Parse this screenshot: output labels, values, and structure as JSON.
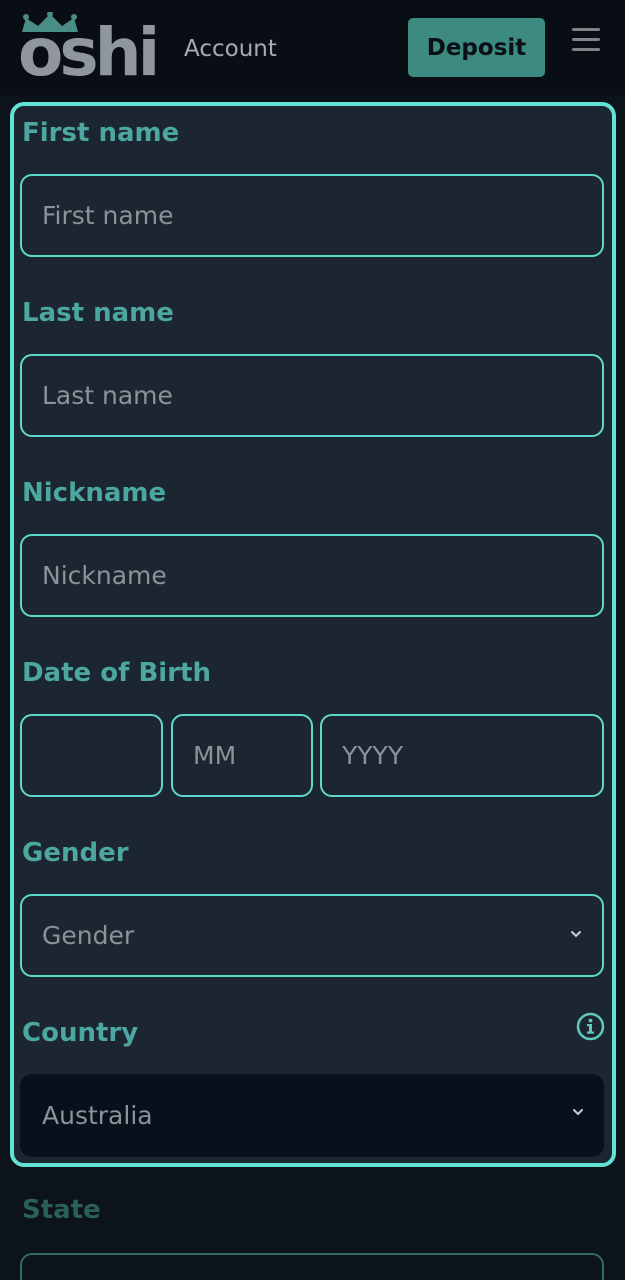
{
  "header": {
    "logo_text": "oshi",
    "page_title": "Account",
    "deposit_label": "Deposit"
  },
  "form": {
    "first_name": {
      "label": "First name",
      "placeholder": "First name"
    },
    "last_name": {
      "label": "Last name",
      "placeholder": "Last name"
    },
    "nickname": {
      "label": "Nickname",
      "placeholder": "Nickname"
    },
    "dob": {
      "label": "Date of Birth",
      "day_placeholder": "",
      "month_placeholder": "MM",
      "year_placeholder": "YYYY"
    },
    "gender": {
      "label": "Gender",
      "value": "Gender"
    },
    "country": {
      "label": "Country",
      "value": "Australia"
    },
    "state": {
      "label": "State"
    }
  },
  "icons": [
    "crown-icon",
    "menu-icon",
    "chevron-down-icon",
    "info-icon"
  ],
  "colors": {
    "accent": "#63e2d6",
    "label": "#4ba79f",
    "deposit_bg": "#3d8b80",
    "panel_bg": "#1c2631",
    "page_bg": "#0d131a"
  }
}
